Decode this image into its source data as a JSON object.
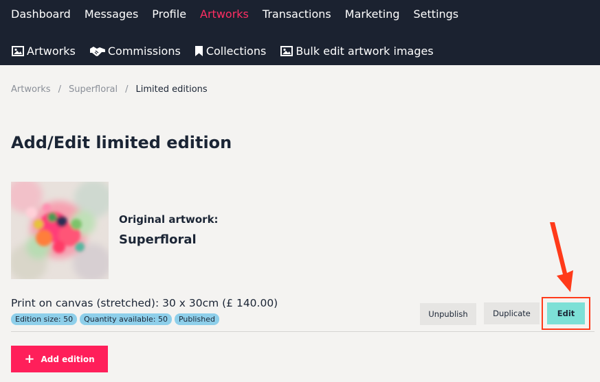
{
  "colors": {
    "nav_bg": "#1b2230",
    "active": "#ff2e63",
    "accent_teal": "#7de0d6",
    "add_red": "#ff1f5a",
    "badge": "#8ecfea",
    "highlight": "#ff3a1a"
  },
  "nav": {
    "main": [
      {
        "label": "Dashboard",
        "active": false
      },
      {
        "label": "Messages",
        "active": false
      },
      {
        "label": "Profile",
        "active": false
      },
      {
        "label": "Artworks",
        "active": true
      },
      {
        "label": "Transactions",
        "active": false
      },
      {
        "label": "Marketing",
        "active": false
      },
      {
        "label": "Settings",
        "active": false
      }
    ],
    "sub": [
      {
        "label": "Artworks",
        "icon": "image-icon"
      },
      {
        "label": "Commissions",
        "icon": "handshake-icon"
      },
      {
        "label": "Collections",
        "icon": "bookmark-icon"
      },
      {
        "label": "Bulk edit artwork images",
        "icon": "image-icon"
      }
    ]
  },
  "breadcrumb": {
    "items": [
      "Artworks",
      "Superfloral",
      "Limited editions"
    ],
    "separator": "/"
  },
  "page": {
    "title": "Add/Edit limited edition"
  },
  "original": {
    "label": "Original artwork:",
    "title": "Superfloral"
  },
  "edition": {
    "description": "Print on canvas (stretched): 30 x 30cm (£ 140.00)",
    "badges": [
      "Edition size: 50",
      "Quantity available: 50",
      "Published"
    ],
    "actions": {
      "unpublish": "Unpublish",
      "duplicate": "Duplicate",
      "edit": "Edit"
    }
  },
  "add_button": {
    "label": "Add edition",
    "icon": "plus-icon"
  }
}
